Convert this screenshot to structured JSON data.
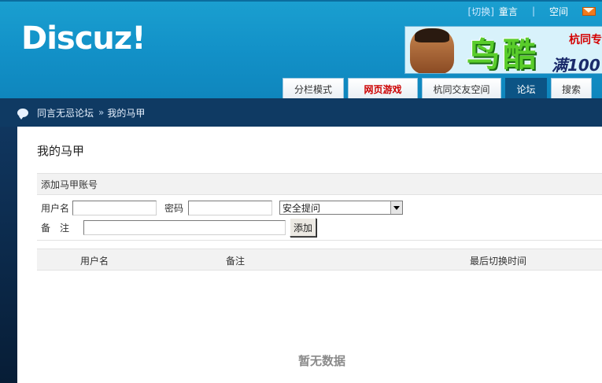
{
  "header": {
    "logo": "Discuz!",
    "topbar": {
      "switch_label": "[切换]",
      "username": "童言",
      "separator": "|",
      "space_label": "空间"
    },
    "banner": {
      "big_text": "鸟酷",
      "tag_text": "杭同专",
      "promo_text": "满100"
    },
    "nav_tabs": [
      {
        "label": "分栏模式"
      },
      {
        "label": "网页游戏"
      },
      {
        "label": "杭同交友空间"
      },
      {
        "label": "论坛"
      },
      {
        "label": "搜索"
      }
    ]
  },
  "breadcrumb": {
    "forum": "同言无忌论坛",
    "separator": "»",
    "current": "我的马甲"
  },
  "main": {
    "title": "我的马甲",
    "add_section": {
      "heading": "添加马甲账号",
      "username_label": "用户名",
      "username_value": "",
      "password_label": "密码",
      "password_value": "",
      "security_question": "安全提问",
      "note_label": "备　注",
      "note_value": "",
      "add_button": "添加"
    },
    "table": {
      "columns": [
        "用户名",
        "备注",
        "最后切换时间"
      ],
      "empty_text": "暂无数据"
    }
  }
}
